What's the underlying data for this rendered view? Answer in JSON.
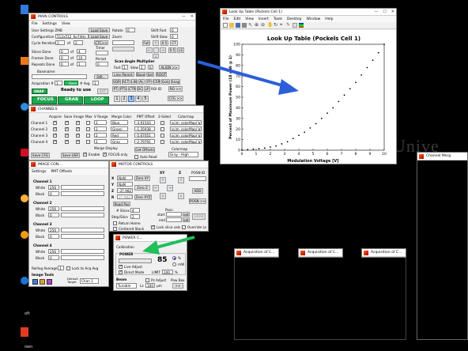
{
  "desktop": {
    "bg_text": "Unive",
    "left_labels": [
      "oft",
      "Rec",
      "S",
      "a",
      "own"
    ]
  },
  "main_controls": {
    "title": "MAIN CONTROLS",
    "menu": [
      "File",
      "Settings",
      "View"
    ],
    "user_settings": "User Settings ZMB",
    "load_save": "Load Save",
    "configuration": "Configuration",
    "config_value": "512x512_6p74Hz_2ir",
    "cycle_iteration": "Cycle Iteration",
    "cycle_value": "1",
    "cycle_of": "of",
    "cycle_total": "2",
    "ctc_btn": "CTC>>",
    "timer_label": "Timer",
    "slices_done": "Slices Done",
    "slices_done_value": "0",
    "slices_of": "4",
    "frames_done": "Frames Done",
    "frames_done_value": "0",
    "frames_of": "10",
    "period_label": "Period",
    "period_value": "0",
    "repeats_done": "Repeats Done",
    "repeats_done_value": "0",
    "repeats_of": "1",
    "basename": "Basename:",
    "dir_btn": "DIR...",
    "acquisition": "Acquisition #",
    "acq_value": "1",
    "save_label": "Save",
    "avg_label": "# Avg",
    "avg_value": "1",
    "status": "Ready to use",
    "snap": "SNAP",
    "ext": "EXT",
    "focus": "FOCUS",
    "grab": "GRAB",
    "loop": "LOOP",
    "rotate_label": "Rotate",
    "rotate_value": "0",
    "zoom_label": "Zoom",
    "shift_fast": "Shift Fast",
    "shift_fast_value": "0",
    "shift_slow": "Shift Slow",
    "shift_slow_value": "0",
    "fullfield": "Full",
    "zoom_buttons": [
      "0.5",
      "CT",
      "0.5",
      "LS"
    ],
    "scan_angle": "Scan Angle Multiplier",
    "fast_label": "Fast",
    "fast_value": "1",
    "slow_label": "Slow",
    "slow_value": "1",
    "lock": "L",
    "align": "ALIGN >>",
    "line_parent": "Line Parent",
    "base_set_root": [
      "Base",
      "Set",
      "ROOT"
    ],
    "roi_row": [
      "SQR",
      "RCT",
      "LIN",
      "AL",
      "FP",
      "CSR",
      "Goto",
      "Snap"
    ],
    "roi_row2": [
      "PT",
      "PTS",
      "CTR",
      "DC",
      "LP",
      "ROI ID"
    ],
    "roi_btn": "RO >>",
    "pages": [
      "1",
      "2",
      "3",
      "4",
      "5"
    ],
    "cfg_btn": "CFG >>"
  },
  "channels": {
    "title": "CHANNELS",
    "headers": [
      "Acquire",
      "Save",
      "Image",
      "Max",
      "V Range",
      "Merge Color",
      "PMT Offset",
      "2-Sided",
      "Colormap"
    ],
    "rows": [
      {
        "name": "Channel 1",
        "vrange": "2",
        "color": "Blue",
        "offset": "-3.91543",
        "cmap": "scim_colorMap('g"
      },
      {
        "name": "Channel 2",
        "vrange": "2",
        "color": "Green",
        "offset": "-1.35938",
        "cmap": "scim_colorMap('g"
      },
      {
        "name": "Channel 3",
        "vrange": "2",
        "color": "Red",
        "offset": "-5.67051",
        "cmap": "scim_colorMap('g"
      },
      {
        "name": "Channel 4",
        "vrange": "2",
        "color": "Gray",
        "offset": "-2.79791",
        "cmap": "scim_colorMap('g"
      }
    ],
    "merge_display": "Merge Display",
    "enable": "Enable",
    "focus_only": "FOCUS only",
    "get_offsets": "Get Offsets",
    "auto_read": "Auto Read",
    "colormap_label": "Colormap",
    "colormap_value": "Gray - High",
    "save_cfg": "Save CFG",
    "save_usr": "Save USR"
  },
  "image_controls": {
    "title": "IMAGE CON...",
    "menu": [
      "Settings",
      "PMT Offsets"
    ],
    "channels": [
      {
        "name": "Channel 1",
        "white": "256",
        "black": "0"
      },
      {
        "name": "Channel 2",
        "white": "256",
        "black": "0"
      },
      {
        "name": "Channel 3",
        "white": "256",
        "black": "0"
      },
      {
        "name": "Channel 4",
        "white": "256",
        "black": "0"
      }
    ],
    "white_label": "White",
    "black_label": "Black",
    "rolling_average": "Rolling Average",
    "rolling_value": "1",
    "lock_to_acq": "Lock to Acq Avg",
    "image_tools": "Image Tools",
    "default_target": "Default Target",
    "target_value": "Chan 1"
  },
  "motor_controls": {
    "title": "MOTOR CONTROLS",
    "x_label": "X",
    "x_value": "NaN",
    "y_label": "Y",
    "y_value": "NaN",
    "z_label": "Z",
    "z_value": "-37.9827",
    "z2_value": "37.9827",
    "r_label": "R",
    "zero_xy": "Zero XY",
    "zero_z": "Zero Z",
    "zero_xyz": "Zero XYZ",
    "read_pos": "Read Pos",
    "xy_label": "XY",
    "z_head": "Z",
    "posn_id": "POSN ID",
    "add": "ADD",
    "posn": "POSN >>",
    "slices_label": "# Slices",
    "slices_value": "4",
    "step_label": "Step/Slice",
    "step_value": "2",
    "posn_label": "Posn",
    "start_label": "start",
    "end_label": "end",
    "set_btn": "set",
    "grab_btn": "GRAB",
    "return_home": "Return Home",
    "centered_stack": "Centered Stack",
    "lock_slice": "Lock slice vals",
    "override_lz": "Override Lz"
  },
  "power_controls": {
    "title": "POWER C...",
    "calibration": "Calibration",
    "power_label": "POWER",
    "power_value": "85",
    "percent": "%",
    "mw": "mW",
    "live_adjust": "Live Adjust",
    "direct_mode": "Direct Mode",
    "limit_label": "LIMIT",
    "limit_value": "100",
    "beam_label": "Beam",
    "beam_value": "Tunable",
    "pz_adjust": "Pz Adjust",
    "lz_label": "Lz",
    "lz_value": "100",
    "um_label": "µm",
    "pow_box": "Pow Box",
    "more": ">>"
  },
  "lut_window": {
    "title": "Look Up Table (Pockels Cell 1)",
    "menu": [
      "File",
      "Edit",
      "View",
      "Insert",
      "Tools",
      "Desktop",
      "Window",
      "Help"
    ]
  },
  "chart_data": {
    "type": "scatter",
    "title": "Look Up Table (Pockels Cell 1)",
    "xlabel": "Modulation Voltage [V]",
    "ylabel": "Percent of Maximum Power (18 mW @ 1)",
    "xlim": [
      0,
      10
    ],
    "ylim": [
      0,
      100
    ],
    "xticks": [
      "0",
      "1",
      "2",
      "3",
      "4",
      "5",
      "6",
      "7",
      "8",
      "9",
      "10"
    ],
    "yticks": [
      "0",
      "10",
      "20",
      "30",
      "40",
      "50",
      "60",
      "70",
      "80",
      "90",
      "100"
    ],
    "x": [
      0,
      0.4,
      0.8,
      1.2,
      1.6,
      2.0,
      2.4,
      2.8,
      3.2,
      3.6,
      4.0,
      4.4,
      4.8,
      5.2,
      5.6,
      6.0,
      6.4,
      6.8,
      7.2,
      7.6,
      8.0,
      8.4,
      8.8,
      9.2,
      9.6,
      10
    ],
    "y": [
      0,
      0.5,
      1,
      1.5,
      2,
      3,
      4,
      6,
      8,
      11,
      14,
      17,
      21,
      25,
      30,
      35,
      40,
      46,
      52,
      58,
      64,
      71,
      78,
      85,
      92,
      100
    ],
    "grid": false
  },
  "small_windows": [
    {
      "title": "Acquisition of C..."
    },
    {
      "title": "Acquisition of C..."
    },
    {
      "title": "Acquisition of C..."
    }
  ],
  "right_window": {
    "title": "Channel Merg"
  },
  "colors": {
    "arrow_blue": "#2b5fd9",
    "arrow_green": "#1fbf5a",
    "focus_green": "#1fa84f"
  }
}
